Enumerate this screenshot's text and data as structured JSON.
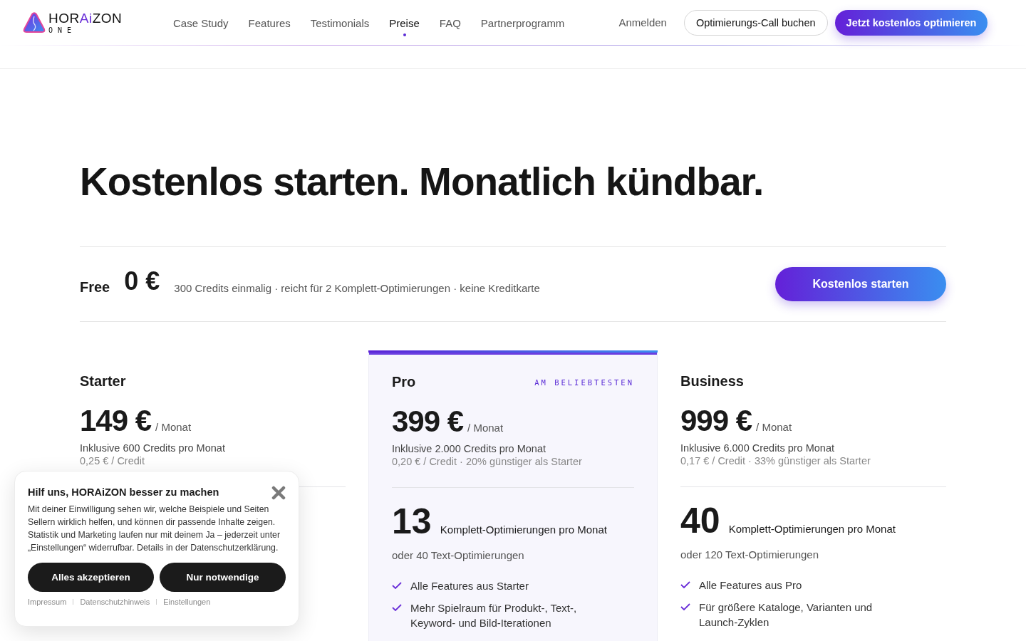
{
  "header": {
    "logo": {
      "name_start": "HOR",
      "name_accent": "Ai",
      "name_end": "ZON",
      "subtitle": "ONE"
    },
    "nav": [
      {
        "label": "Case Study",
        "selected": false
      },
      {
        "label": "Features",
        "selected": false
      },
      {
        "label": "Testimonials",
        "selected": false
      },
      {
        "label": "Preise",
        "selected": true
      },
      {
        "label": "FAQ",
        "selected": false
      },
      {
        "label": "Partnerprogramm",
        "selected": false
      }
    ],
    "login": "Anmelden",
    "secondary_button": "Optimierungs-Call buchen",
    "primary_button": "Jetzt kostenlos optimieren"
  },
  "heading": "Kostenlos starten. Monatlich kündbar.",
  "free_plan": {
    "name": "Free",
    "price": "0 €",
    "description": "300 Credits einmalig · reicht für 2 Komplett-Optimierungen · keine Kreditkarte",
    "button": "Kostenlos starten"
  },
  "plans": [
    {
      "name": "Starter",
      "featured": false,
      "price": "149 €",
      "period": "/ Monat",
      "credits": "Inklusive 600 Credits pro Monat",
      "per_credit": "0,25 € / Credit"
    },
    {
      "name": "Pro",
      "featured": true,
      "badge": "AM BELIEBTESTEN",
      "price": "399 €",
      "period": "/ Monat",
      "credits": "Inklusive 2.000 Credits pro Monat",
      "per_credit": "0,20 € / Credit · 20% günstiger als Starter",
      "count": "13",
      "count_label": "Komplett-Optimierungen pro Monat",
      "alt": "oder 40 Text-Optimierungen",
      "features": [
        "Alle Features aus Starter",
        "Mehr Spielraum für Produkt-, Text-, Keyword- und Bild-Iterationen"
      ]
    },
    {
      "name": "Business",
      "featured": false,
      "price": "999 €",
      "period": "/ Monat",
      "credits": "Inklusive 6.000 Credits pro Monat",
      "per_credit": "0,17 € / Credit · 33% günstiger als Starter",
      "count": "40",
      "count_label": "Komplett-Optimierungen pro Monat",
      "alt": "oder 120 Text-Optimierungen",
      "features": [
        "Alle Features aus Pro",
        "Für größere Kataloge, Varianten und Launch-Zyklen"
      ]
    }
  ],
  "cookie_banner": {
    "title": "Hilf uns, HORAiZON besser zu machen",
    "text": "Mit deiner Einwilligung sehen wir, welche Beispiele und Seiten Sellern wirklich helfen, und können dir passende Inhalte zeigen. Statistik und Marketing laufen nur mit deinem Ja – jederzeit unter „Einstellungen“ widerrufbar. Details in der Datenschutzerklärung.",
    "buttons": [
      "Alles akzeptieren",
      "Nur notwendige"
    ],
    "links": [
      "Impressum",
      "Datenschutzhinweis",
      "Einstellungen"
    ]
  }
}
